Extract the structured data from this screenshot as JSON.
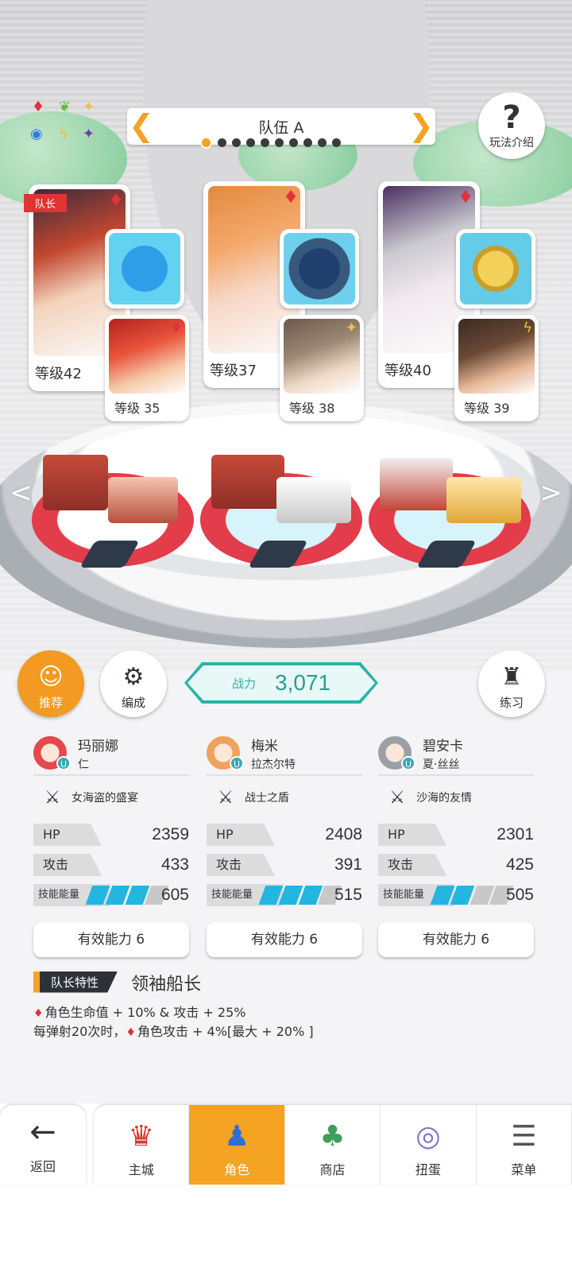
{
  "team": {
    "title": "队伍 A",
    "page_count": 10,
    "active_page": 0
  },
  "help": {
    "label": "玩法介绍"
  },
  "leader_tag": "队长",
  "cards": [
    {
      "main_level": "等级42",
      "sub_level": "等级 35",
      "main_element_icon": "diamond-red-icon",
      "sub_element_icon": "diamond-red-icon",
      "weapon_icon": "ship-orb-icon"
    },
    {
      "main_level": "等级37",
      "sub_level": "等级 38",
      "main_element_icon": "diamond-red-icon",
      "sub_element_icon": "sparkle-icon",
      "weapon_icon": "shield-frame-icon"
    },
    {
      "main_level": "等级40",
      "sub_level": "等级 39",
      "main_element_icon": "diamond-red-icon",
      "sub_element_icon": "lightning-icon",
      "weapon_icon": "gold-ingot-icon"
    }
  ],
  "buttons": {
    "recommend": "推荐",
    "formation": "编成",
    "practice": "练习"
  },
  "power": {
    "label": "战力",
    "value": "3,071"
  },
  "characters": [
    {
      "name": "玛丽娜",
      "title": "仁",
      "weapon": "女海盗的盛宴",
      "hp_label": "HP",
      "hp": "2359",
      "atk_label": "攻击",
      "atk": "433",
      "energy_label": "技能能量",
      "energy": "605",
      "energy_fill": 0.75,
      "ability": "有效能力 6",
      "avatar_color": "#e5484d"
    },
    {
      "name": "梅米",
      "title": "拉杰尔特",
      "weapon": "战士之盾",
      "hp_label": "HP",
      "hp": "2408",
      "atk_label": "攻击",
      "atk": "391",
      "energy_label": "技能能量",
      "energy": "515",
      "energy_fill": 0.75,
      "ability": "有效能力 6",
      "avatar_color": "#f0a15c"
    },
    {
      "name": "碧安卡",
      "title": "夏·丝丝",
      "weapon": "沙海的友情",
      "hp_label": "HP",
      "hp": "2301",
      "atk_label": "攻击",
      "atk": "425",
      "energy_label": "技能能量",
      "energy": "505",
      "energy_fill": 0.5,
      "ability": "有效能力 6",
      "avatar_color": "#9aa0a6"
    }
  ],
  "leader_skill": {
    "tag": "队长特性",
    "name": "领袖船长",
    "line1": "角色生命值 + 10% & 攻击 + 25%",
    "line2_prefix": "每弹射20次时，",
    "line2_suffix": "角色攻击 + 4%[最大 + 20% ]"
  },
  "nav": {
    "back": "返回",
    "items": [
      "主城",
      "角色",
      "商店",
      "扭蛋",
      "菜单"
    ],
    "active": "角色"
  },
  "colors": {
    "accent": "#f5a323",
    "teal": "#2bb3a6",
    "element_red": "#e0323a",
    "energy_blue": "#23b6e0"
  }
}
